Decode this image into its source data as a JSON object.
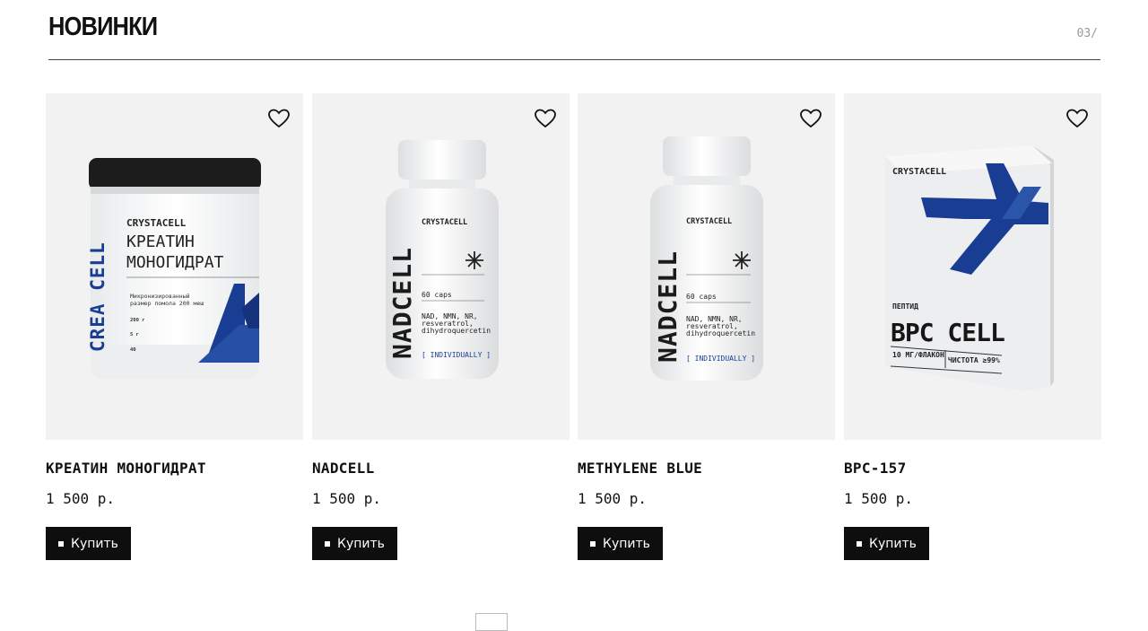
{
  "section": {
    "title": "НОВИНКИ",
    "counter": "03/"
  },
  "products": [
    {
      "name": "КРЕАТИН МОНОГИДРАТ",
      "price": "1 500 р.",
      "buy_label": "Купить",
      "image": {
        "brand": "CRYSTACELL",
        "vertical": "CREA CELL",
        "title_line1": "КРЕАТИН",
        "title_line2": "МОНОГИДРАТ",
        "desc_line1": "Микронизированный",
        "desc_line2": "размер помола 200 меш",
        "spec1": "200 г",
        "spec2": "5 г",
        "spec3": "40"
      }
    },
    {
      "name": "NADCELL",
      "price": "1 500 р.",
      "buy_label": "Купить",
      "image": {
        "brand": "CRYSTACELL",
        "vertical": "NADCELL",
        "caps": "60 caps",
        "ingr1": "NAD, NMN, NR,",
        "ingr2": "resveratrol,",
        "ingr3": "dihydroquercetin",
        "tag": "[ INDIVIDUALLY ]"
      }
    },
    {
      "name": "METHYLENE BLUE",
      "price": "1 500 р.",
      "buy_label": "Купить",
      "image": {
        "brand": "CRYSTACELL",
        "vertical": "NADCELL",
        "caps": "60 caps",
        "ingr1": "NAD, NMN, NR,",
        "ingr2": "resveratrol,",
        "ingr3": "dihydroquercetin",
        "tag": "[ INDIVIDUALLY ]"
      }
    },
    {
      "name": "BPC-157",
      "price": "1 500 р.",
      "buy_label": "Купить",
      "image": {
        "brand": "CRYSTACELL",
        "kind": "ПЕПТИД",
        "title": "BPC CELL",
        "spec1": "10 МГ/ФЛАКОН",
        "spec2": "ЧИСТОТА ≥99%"
      }
    }
  ],
  "colors": {
    "accent": "#1a3d94",
    "button": "#0e0e0e",
    "card_bg": "#f2f2f2"
  },
  "icons": {
    "favorite": "heart-icon"
  }
}
